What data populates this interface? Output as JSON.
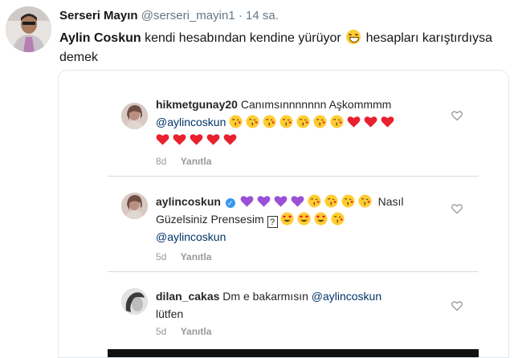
{
  "tweet": {
    "author_name": "Serseri Mayın",
    "author_handle": "@serseri_mayin1",
    "separator": "·",
    "time": "14 sa.",
    "mention": "Aylin Coskun",
    "text_before_emoji": "kendi hesabından kendine yürüyor",
    "emoji": "grinning-face",
    "text_after_emoji": "hesapları karıştırdıysa demek"
  },
  "screenshot": {
    "comments": [
      {
        "username": "hikmetgunay20",
        "text": "Canımsınnnnnnn Aşkommmm",
        "mention": "@aylincoskun",
        "emojis_line1": [
          "kiss",
          "kiss",
          "kiss",
          "kiss",
          "kiss",
          "kiss",
          "kiss",
          "heart",
          "heart",
          "heart"
        ],
        "emojis_line2": [
          "heart",
          "heart",
          "heart",
          "heart",
          "heart"
        ],
        "age": "8d",
        "reply_label": "Yanıtla"
      },
      {
        "username": "aylincoskun",
        "verified": true,
        "emojis_line1": [
          "purple-heart",
          "purple-heart",
          "purple-heart",
          "purple-heart",
          "kiss",
          "kiss",
          "kiss",
          "kiss"
        ],
        "text_word1": "Nasıl",
        "text_line2": "Güzelsiniz Prensesim",
        "unknown_glyph": "?",
        "emojis_line2": [
          "heart-eyes",
          "heart-eyes",
          "heart-eyes",
          "kiss"
        ],
        "mention": "@aylincoskun",
        "age": "5d",
        "reply_label": "Yanıtla"
      },
      {
        "username": "dilan_cakas",
        "text": "Dm e bakarmısın",
        "mention": "@aylincoskun",
        "text_line2": "lütfen",
        "age": "5d",
        "reply_label": "Yanıtla"
      }
    ]
  },
  "colors": {
    "twitter_text": "#14171a",
    "twitter_gray": "#657786",
    "ig_text": "#262626",
    "ig_mention": "#003569",
    "ig_meta": "#999999",
    "emoji_heart": "#e8212e",
    "emoji_purple_heart": "#9b50d8",
    "emoji_face": "#ffcc33"
  }
}
